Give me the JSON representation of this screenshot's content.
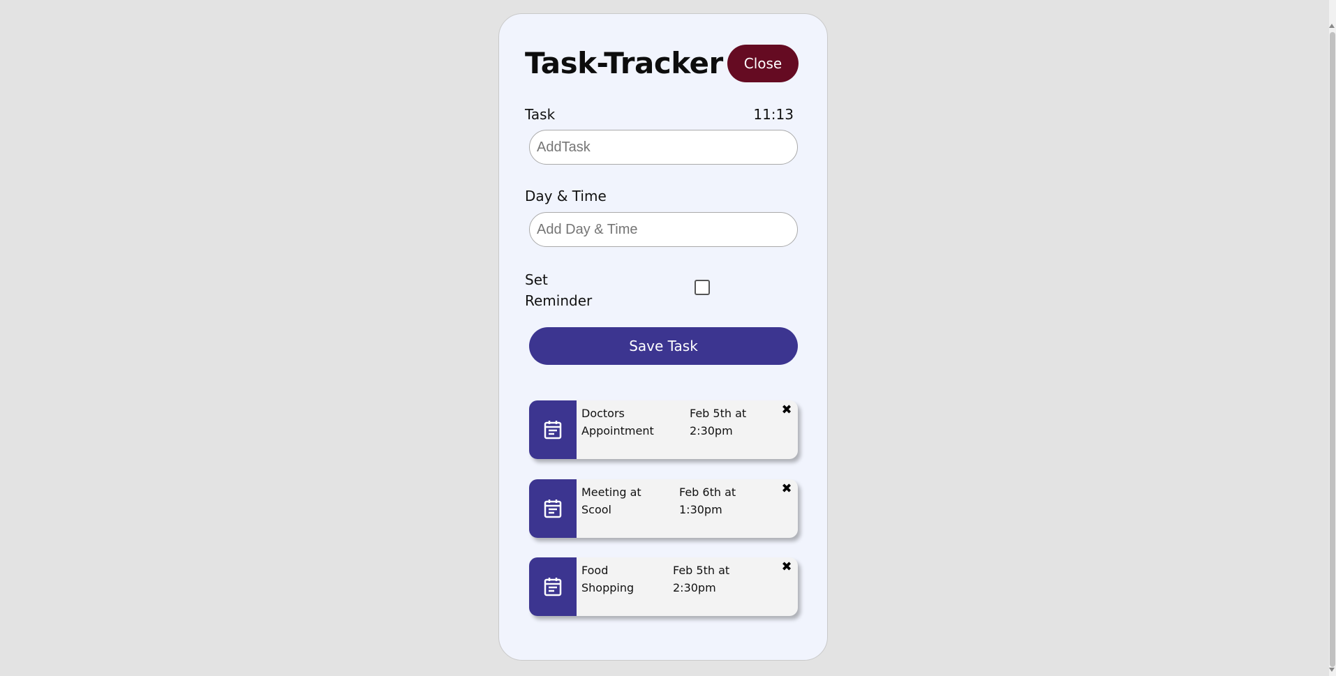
{
  "header": {
    "title": "Task-Tracker",
    "close_label": "Close"
  },
  "form": {
    "task_label": "Task",
    "clock": "11:13",
    "task_placeholder": "AddTask",
    "datetime_label": "Day & Time",
    "datetime_placeholder": "Add Day & Time",
    "reminder_label": "Set Reminder",
    "reminder_checked": false,
    "save_label": "Save Task"
  },
  "tasks": [
    {
      "text": "Doctors Appointment",
      "day": "Feb 5th at 2:30pm",
      "icon": "calendar-icon",
      "delete_icon": "close-icon"
    },
    {
      "text": "Meeting at Scool",
      "day": "Feb 6th at 1:30pm",
      "icon": "calendar-icon",
      "delete_icon": "close-icon"
    },
    {
      "text": "Food Shopping",
      "day": "Feb 5th at 2:30pm",
      "icon": "calendar-icon",
      "delete_icon": "close-icon"
    }
  ],
  "colors": {
    "background": "#e3e3e3",
    "card": "#f1f4fd",
    "close_button": "#650b22",
    "accent": "#3c3590",
    "task_item": "#f3f3f3"
  }
}
